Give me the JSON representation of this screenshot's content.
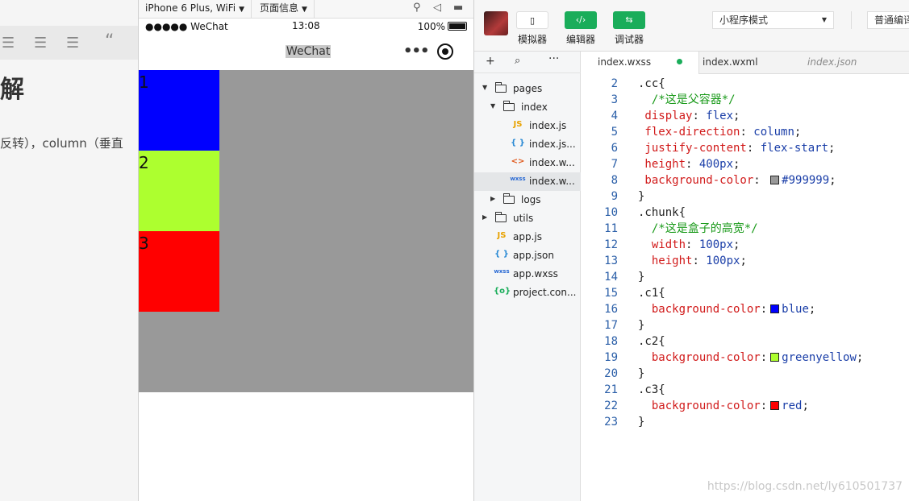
{
  "doc": {
    "heading": "解",
    "paragraph": "反转），column（垂直"
  },
  "simulator": {
    "device": "iPhone 6 Plus, WiFi",
    "page_info": "页面信息",
    "status": {
      "carrier": "●●●●● WeChat",
      "time": "13:08",
      "battery": "100%"
    },
    "nav_title": "WeChat",
    "container_color": "#999999",
    "chunks": [
      {
        "label": "1",
        "color": "#0000ff"
      },
      {
        "label": "2",
        "color": "#adff2f"
      },
      {
        "label": "3",
        "color": "#ff0000"
      }
    ]
  },
  "ide": {
    "buttons": [
      {
        "label": "模拟器",
        "icon": "phone-icon"
      },
      {
        "label": "编辑器",
        "icon": "code-icon"
      },
      {
        "label": "调试器",
        "icon": "debug-icon"
      }
    ],
    "mode_select": "小程序模式",
    "compile_select": "普通编译",
    "tree": [
      {
        "name": "pages",
        "type": "folder",
        "open": true,
        "depth": 0
      },
      {
        "name": "index",
        "type": "folder",
        "open": true,
        "depth": 1
      },
      {
        "name": "index.js",
        "type": "js",
        "depth": 2
      },
      {
        "name": "index.js...",
        "type": "json",
        "depth": 2
      },
      {
        "name": "index.w...",
        "type": "wxml",
        "depth": 2
      },
      {
        "name": "index.w...",
        "type": "wxss",
        "depth": 2,
        "selected": true
      },
      {
        "name": "logs",
        "type": "folder",
        "open": false,
        "depth": 1
      },
      {
        "name": "utils",
        "type": "folder",
        "open": false,
        "depth": 0
      },
      {
        "name": "app.js",
        "type": "js",
        "depth": 0
      },
      {
        "name": "app.json",
        "type": "json",
        "depth": 0
      },
      {
        "name": "app.wxss",
        "type": "wxss",
        "depth": 0
      },
      {
        "name": "project.con...",
        "type": "config",
        "depth": 0
      }
    ],
    "tabs": [
      {
        "label": "index.wxss",
        "active": true,
        "modified": true
      },
      {
        "label": "index.wxml"
      },
      {
        "label": "index.json",
        "italic": true
      }
    ],
    "code": [
      {
        "n": "2",
        "parts": [
          [
            "sel",
            ".cc{"
          ]
        ]
      },
      {
        "n": "3",
        "parts": [
          [
            "cm",
            "  /*这是父容器*/"
          ]
        ]
      },
      {
        "n": "4",
        "parts": [
          [
            "prop",
            " display"
          ],
          [
            "punc",
            ": "
          ],
          [
            "val",
            "flex"
          ],
          [
            "punc",
            ";"
          ]
        ]
      },
      {
        "n": "5",
        "parts": [
          [
            "prop",
            " flex-direction"
          ],
          [
            "punc",
            ": "
          ],
          [
            "val",
            "column"
          ],
          [
            "punc",
            ";"
          ]
        ]
      },
      {
        "n": "6",
        "parts": [
          [
            "prop",
            " justify-content"
          ],
          [
            "punc",
            ": "
          ],
          [
            "val",
            "flex-start"
          ],
          [
            "punc",
            ";"
          ]
        ]
      },
      {
        "n": "7",
        "parts": [
          [
            "prop",
            " height"
          ],
          [
            "punc",
            ": "
          ],
          [
            "val",
            "400px"
          ],
          [
            "punc",
            ";"
          ]
        ]
      },
      {
        "n": "8",
        "parts": [
          [
            "prop",
            " background-color"
          ],
          [
            "punc",
            ": "
          ],
          [
            "swatch",
            "#999999"
          ],
          [
            "val",
            "#999999"
          ],
          [
            "punc",
            ";"
          ]
        ]
      },
      {
        "n": "9",
        "parts": [
          [
            "sel",
            "}"
          ]
        ]
      },
      {
        "n": "10",
        "parts": [
          [
            "sel",
            ".chunk{"
          ]
        ]
      },
      {
        "n": "11",
        "parts": [
          [
            "cm",
            "  /*这是盒子的高宽*/"
          ]
        ]
      },
      {
        "n": "12",
        "parts": [
          [
            "prop",
            "  width"
          ],
          [
            "punc",
            ": "
          ],
          [
            "val",
            "100px"
          ],
          [
            "punc",
            ";"
          ]
        ]
      },
      {
        "n": "13",
        "parts": [
          [
            "prop",
            "  height"
          ],
          [
            "punc",
            ": "
          ],
          [
            "val",
            "100px"
          ],
          [
            "punc",
            ";"
          ]
        ]
      },
      {
        "n": "14",
        "parts": [
          [
            "sel",
            "}"
          ]
        ]
      },
      {
        "n": "15",
        "parts": [
          [
            "sel",
            ".c1{"
          ]
        ]
      },
      {
        "n": "16",
        "parts": [
          [
            "prop",
            "  background-color"
          ],
          [
            "punc",
            ":"
          ],
          [
            "swatch",
            "#0000ff"
          ],
          [
            "val",
            "blue"
          ],
          [
            "punc",
            ";"
          ]
        ]
      },
      {
        "n": "17",
        "parts": [
          [
            "sel",
            "}"
          ]
        ]
      },
      {
        "n": "18",
        "parts": [
          [
            "sel",
            ".c2{"
          ]
        ]
      },
      {
        "n": "19",
        "parts": [
          [
            "prop",
            "  background-color"
          ],
          [
            "punc",
            ":"
          ],
          [
            "swatch",
            "#adff2f"
          ],
          [
            "val",
            "greenyellow"
          ],
          [
            "punc",
            ";"
          ]
        ]
      },
      {
        "n": "20",
        "parts": [
          [
            "sel",
            "}"
          ]
        ]
      },
      {
        "n": "21",
        "parts": [
          [
            "sel",
            ".c3{"
          ]
        ]
      },
      {
        "n": "22",
        "parts": [
          [
            "prop",
            "  background-color"
          ],
          [
            "punc",
            ":"
          ],
          [
            "swatch",
            "#ff0000"
          ],
          [
            "val",
            "red"
          ],
          [
            "punc",
            ";"
          ]
        ]
      },
      {
        "n": "23",
        "parts": [
          [
            "sel",
            "}"
          ]
        ]
      }
    ],
    "watermark": "https://blog.csdn.net/ly610501737"
  },
  "colors": {
    "accent_green": "#1aad5a"
  }
}
